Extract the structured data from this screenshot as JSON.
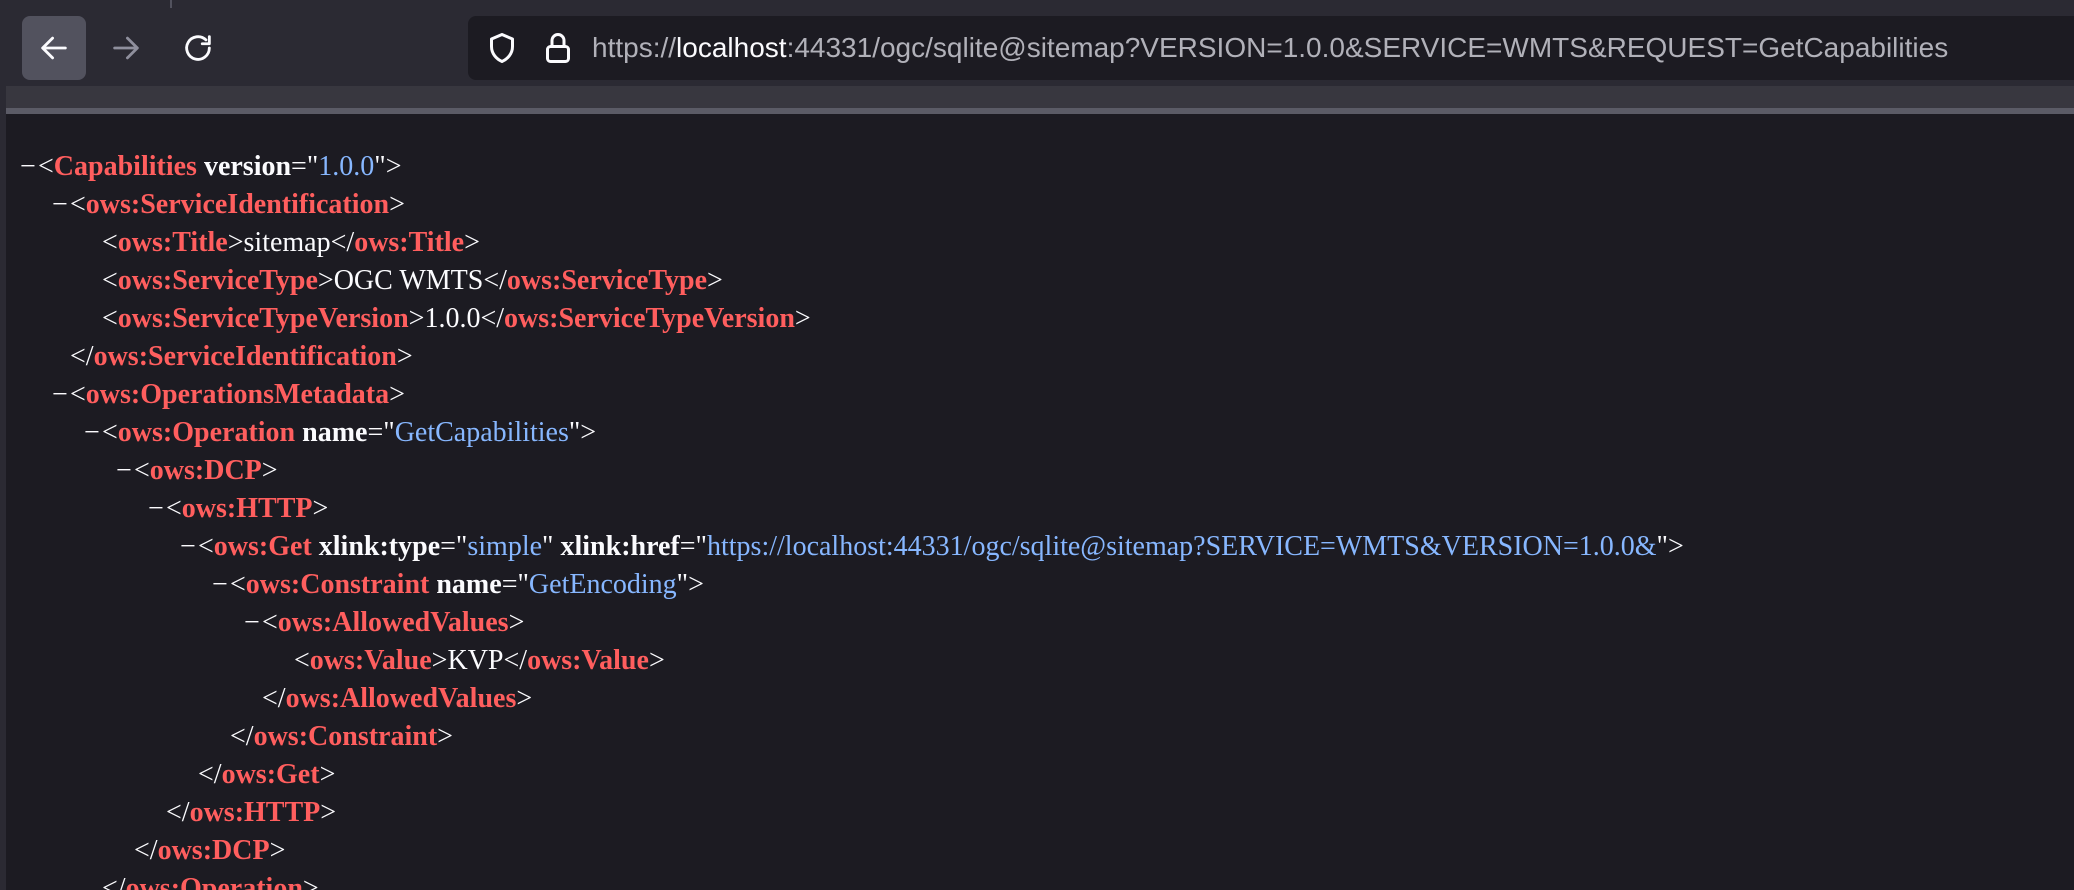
{
  "browser": {
    "url_prefix": "https://",
    "url_host": "localhost",
    "url_rest": ":44331/ogc/sqlite@sitemap?VERSION=1.0.0&SERVICE=WMTS&REQUEST=GetCapabilities"
  },
  "xml": {
    "collapse_glyph": "−",
    "lines": [
      {
        "tag": "Capabilities",
        "attr1": "version",
        "val1": "1.0.0"
      },
      {
        "tag": "ows:ServiceIdentification"
      },
      {
        "tag": "ows:Title",
        "text": "sitemap"
      },
      {
        "tag": "ows:ServiceType",
        "text": "OGC WMTS"
      },
      {
        "tag": "ows:ServiceTypeVersion",
        "text": "1.0.0"
      },
      {
        "tag": "ows:ServiceIdentification"
      },
      {
        "tag": "ows:OperationsMetadata"
      },
      {
        "tag": "ows:Operation",
        "attr1": "name",
        "val1": "GetCapabilities"
      },
      {
        "tag": "ows:DCP"
      },
      {
        "tag": "ows:HTTP"
      },
      {
        "tag": "ows:Get",
        "attr1": "xlink:type",
        "val1": "simple",
        "attr2": "xlink:href",
        "val2": "https://localhost:44331/ogc/sqlite@sitemap?SERVICE=WMTS&VERSION=1.0.0&"
      },
      {
        "tag": "ows:Constraint",
        "attr1": "name",
        "val1": "GetEncoding"
      },
      {
        "tag": "ows:AllowedValues"
      },
      {
        "tag": "ows:Value",
        "text": "KVP"
      },
      {
        "tag": "ows:AllowedValues"
      },
      {
        "tag": "ows:Constraint"
      },
      {
        "tag": "ows:Get"
      },
      {
        "tag": "ows:HTTP"
      },
      {
        "tag": "ows:DCP"
      },
      {
        "tag": "ows:Operation"
      }
    ]
  }
}
